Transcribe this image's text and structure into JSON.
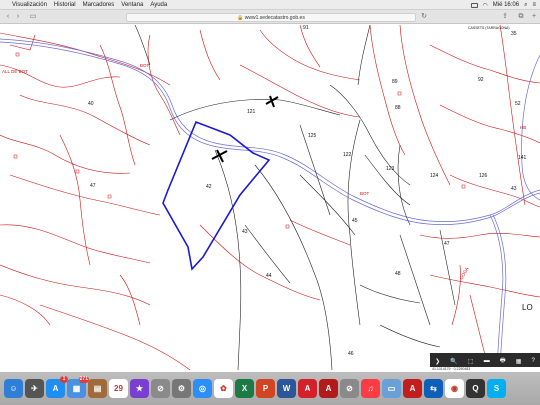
{
  "menubar": {
    "items": [
      "Visualización",
      "Historial",
      "Marcadores",
      "Ventana",
      "Ayuda"
    ],
    "clock": "Mié 16:06"
  },
  "browser": {
    "url": "www1.sedecatastro.gob.es"
  },
  "map": {
    "parcel_labels": [
      "91",
      "40",
      "47",
      "42",
      "43",
      "44",
      "46",
      "45",
      "125",
      "122",
      "123",
      "124",
      "126",
      "121",
      "89",
      "88",
      "92",
      "141",
      "47",
      "48",
      "52",
      "43",
      "35"
    ],
    "road_labels": [
      "BOT",
      "BOT",
      "GOGA",
      "HB"
    ],
    "place_labels": [
      "ALL DE BOT",
      "LO",
      "CASSETS (TARRAGONA)"
    ]
  },
  "nav_controls": {
    "buttons": [
      "❯",
      "🔍",
      "⬚",
      "▬",
      "🖶",
      "▦",
      "?"
    ],
    "coords": "41.1014179 · 0.2290483"
  },
  "dock": {
    "apps": [
      {
        "name": "Finder",
        "color": "#2f7fd8",
        "glyph": "☺"
      },
      {
        "name": "Launchpad",
        "color": "#555",
        "glyph": "✈"
      },
      {
        "name": "App Store",
        "color": "#1f8ef1",
        "glyph": "A",
        "badge": "1"
      },
      {
        "name": "Image",
        "color": "#4a90e2",
        "glyph": "▦",
        "badge": "271"
      },
      {
        "name": "Notes",
        "color": "#a06a3a",
        "glyph": "▤"
      },
      {
        "name": "Calendar",
        "color": "#ffffff",
        "glyph": "29"
      },
      {
        "name": "iMovie",
        "color": "#7b3fd0",
        "glyph": "★"
      },
      {
        "name": "No entry",
        "color": "#8a8a8a",
        "glyph": "⊘"
      },
      {
        "name": "System Preferences",
        "color": "#777",
        "glyph": "⚙"
      },
      {
        "name": "Safari",
        "color": "#2a8ff7",
        "glyph": "◎"
      },
      {
        "name": "Photos",
        "color": "#ffffff",
        "glyph": "✿"
      },
      {
        "name": "Excel",
        "color": "#1d7a45",
        "glyph": "X"
      },
      {
        "name": "PowerPoint",
        "color": "#d14424",
        "glyph": "P"
      },
      {
        "name": "Word",
        "color": "#2b579a",
        "glyph": "W"
      },
      {
        "name": "Acrobat",
        "color": "#d4202a",
        "glyph": "A"
      },
      {
        "name": "Acrobat",
        "color": "#b31b1b",
        "glyph": "A"
      },
      {
        "name": "No entry",
        "color": "#8a8a8a",
        "glyph": "⊘"
      },
      {
        "name": "Music",
        "color": "#fc3c44",
        "glyph": "♫"
      },
      {
        "name": "Preview",
        "color": "#6aa0d8",
        "glyph": "▭"
      },
      {
        "name": "Acrobat",
        "color": "#c31e1e",
        "glyph": "A"
      },
      {
        "name": "TeamViewer",
        "color": "#0e5fb8",
        "glyph": "⇆"
      },
      {
        "name": "Chrome",
        "color": "#ffffff",
        "glyph": "◉"
      },
      {
        "name": "QuickTime",
        "color": "#333",
        "glyph": "Q"
      },
      {
        "name": "Skype",
        "color": "#00aff0",
        "glyph": "S"
      }
    ]
  },
  "colors": {
    "parcel_line": "#d01010",
    "road_line": "#6a6ad8",
    "selection": "#1a1ad0",
    "black_line": "#222222"
  }
}
